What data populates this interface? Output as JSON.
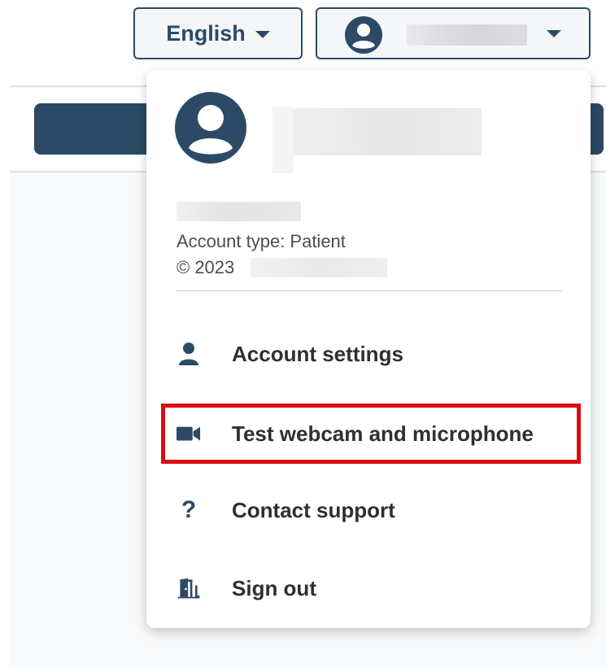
{
  "header": {
    "language_button": {
      "label": "English",
      "icon": "chevron-down-icon"
    },
    "user_button": {
      "avatar_icon": "user-circle-icon",
      "name": "",
      "dropdown_icon": "chevron-down-icon"
    }
  },
  "dropdown": {
    "profile": {
      "avatar_icon": "user-circle-icon",
      "name": "",
      "email": "",
      "account_type": "Account type: Patient",
      "copyright_prefix": "© 2023",
      "copyright_owner": ""
    },
    "menu_items": [
      {
        "label": "Account settings",
        "icon": "user-icon"
      },
      {
        "label": "Test webcam and microphone",
        "icon": "video-camera-icon",
        "highlighted": true
      },
      {
        "label": "Contact support",
        "icon": "question-icon"
      },
      {
        "label": "Sign out",
        "icon": "door-exit-icon"
      }
    ]
  },
  "colors": {
    "brand": "#2c4a66",
    "highlight_border": "#d80f0f",
    "text": "#2f2f2f",
    "muted_text": "#4d4d4d"
  }
}
